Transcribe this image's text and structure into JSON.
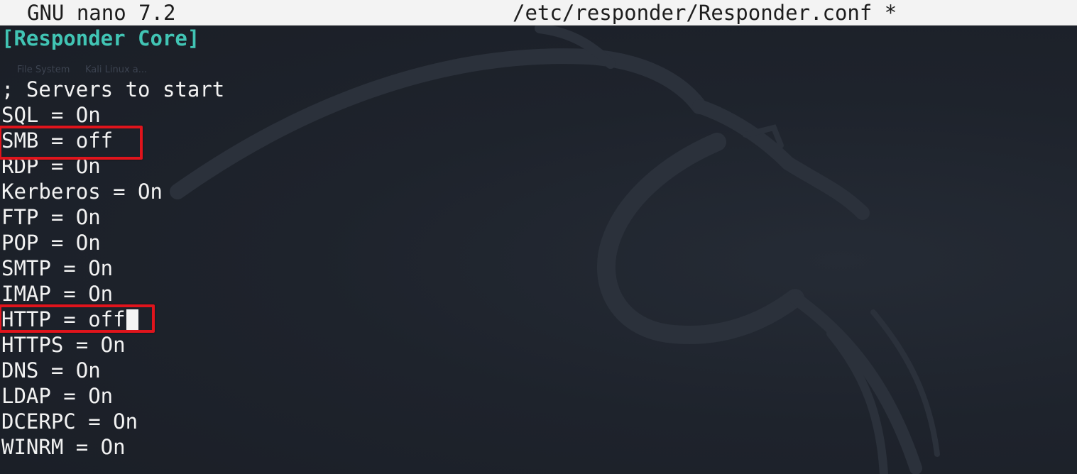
{
  "titlebar": {
    "app_name": "GNU nano 7.2",
    "file_path": "/etc/responder/Responder.conf *"
  },
  "editor": {
    "lines": [
      "[Responder Core]",
      "",
      "; Servers to start",
      "SQL = On",
      "SMB = off",
      "RDP = On",
      "Kerberos = On",
      "FTP = On",
      "POP = On",
      "SMTP = On",
      "IMAP = On",
      "HTTP = off",
      "HTTPS = On",
      "DNS = On",
      "LDAP = On",
      "DCERPC = On",
      "WINRM = On"
    ]
  },
  "desktop_ghosts": {
    "file_system": "File System",
    "kali_linux": "Kali Linux a..."
  },
  "colors": {
    "section_header": "#41c4b4",
    "text": "#f2f2f2",
    "highlight_box": "#e0141c",
    "background": "#1d222b",
    "titlebar": "#f3f3f3"
  }
}
